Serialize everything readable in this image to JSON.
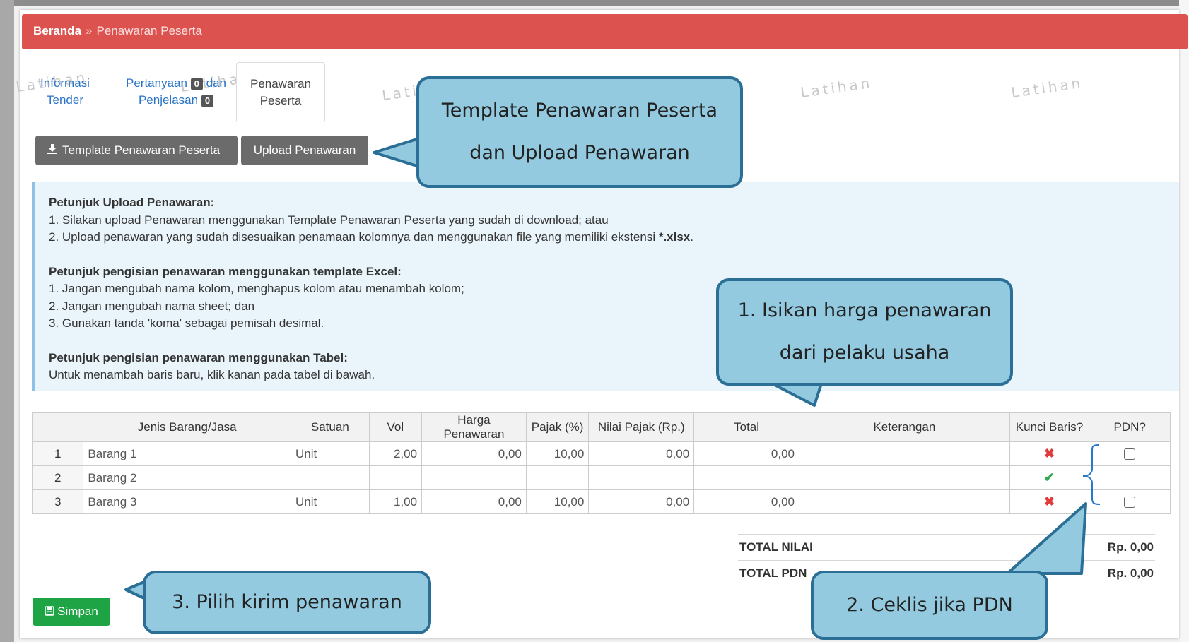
{
  "breadcrumb": {
    "home": "Beranda",
    "separator": "»",
    "current": "Penawaran Peserta"
  },
  "tabs": {
    "info": {
      "line1": "Informasi",
      "line2": "Tender"
    },
    "tanya": {
      "line1": "Pertanyaan",
      "count1": "0",
      "line1b": "dan",
      "line2": "Penjelasan",
      "count2": "0"
    },
    "penawaran": {
      "line1": "Penawaran",
      "line2": "Peserta"
    }
  },
  "watermark_text": "Latihan",
  "buttons": {
    "template_label": "Template Penawaran Peserta",
    "upload_label": "Upload Penawaran",
    "simpan_label": "Simpan"
  },
  "instructions": {
    "upload_heading": "Petunjuk Upload Penawaran:",
    "upload_1": "1. Silakan upload Penawaran menggunakan Template Penawaran Peserta yang sudah di download; atau",
    "upload_2_pre": "2. Upload penawaran yang sudah disesuaikan penamaan kolomnya dan menggunakan file yang memiliki ekstensi ",
    "upload_2_ext": "*.xlsx",
    "upload_2_post": ".",
    "excel_heading": "Petunjuk pengisian penawaran menggunakan template Excel:",
    "excel_1": "1. Jangan mengubah nama kolom, menghapus kolom atau menambah kolom;",
    "excel_2": "2. Jangan mengubah nama sheet; dan",
    "excel_3": "3. Gunakan tanda 'koma' sebagai pemisah desimal.",
    "table_heading": "Petunjuk pengisian penawaran menggunakan Tabel:",
    "table_1": "Untuk menambah baris baru, klik kanan pada tabel di bawah."
  },
  "table": {
    "headers": [
      "",
      "Jenis Barang/Jasa",
      "Satuan",
      "Vol",
      "Harga Penawaran",
      "Pajak (%)",
      "Nilai Pajak (Rp.)",
      "Total",
      "Keterangan",
      "Kunci Baris?",
      "PDN?"
    ],
    "rows": [
      {
        "no": "1",
        "jenis": "Barang 1",
        "satuan": "Unit",
        "vol": "2,00",
        "harga": "0,00",
        "pajak": "10,00",
        "nilai_pajak": "0,00",
        "total": "0,00",
        "keterangan": "",
        "kunci": "x",
        "pdn": "checkbox"
      },
      {
        "no": "2",
        "jenis": "Barang 2",
        "satuan": "",
        "vol": "",
        "harga": "",
        "pajak": "",
        "nilai_pajak": "",
        "total": "",
        "keterangan": "",
        "kunci": "check",
        "pdn": ""
      },
      {
        "no": "3",
        "jenis": "Barang 3",
        "satuan": "Unit",
        "vol": "1,00",
        "harga": "0,00",
        "pajak": "10,00",
        "nilai_pajak": "0,00",
        "total": "0,00",
        "keterangan": "",
        "kunci": "x",
        "pdn": "checkbox"
      }
    ]
  },
  "totals": {
    "total_nilai_label": "TOTAL NILAI",
    "total_nilai_value": "Rp. 0,00",
    "total_pdn_label": "TOTAL PDN",
    "total_pdn_value": "Rp. 0,00"
  },
  "callouts": {
    "template_line1": "Template Penawaran Peserta",
    "template_line2": "dan Upload Penawaran",
    "harga_line1": "1. Isikan harga penawaran",
    "harga_line2": "dari pelaku usaha",
    "pdn": "2. Ceklis jika PDN",
    "kirim": "3. Pilih kirim penawaran"
  },
  "colors": {
    "breadcrumb_bg": "#dc524f",
    "callout_fill": "#93cadf",
    "callout_border": "#2c6f96",
    "save_green": "#1ea444",
    "dark_button": "#6b6b6b"
  }
}
